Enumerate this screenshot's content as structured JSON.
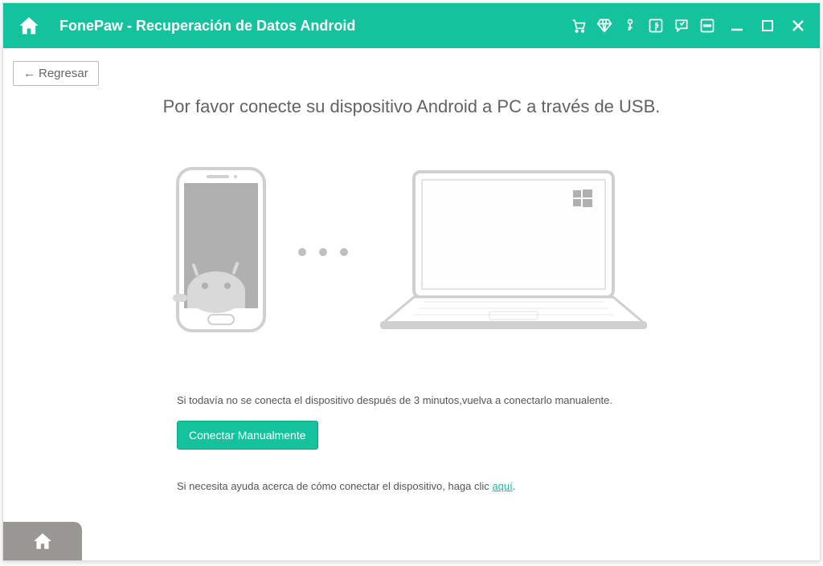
{
  "header": {
    "title": "FonePaw - Recuperación de Datos Android"
  },
  "back": {
    "label": "Regresar"
  },
  "main": {
    "heading": "Por favor conecte su dispositivo Android a PC a través de USB.",
    "hint": "Si todavía no se conecta el dispositivo después de 3 minutos,vuelva a conectarlo manualente.",
    "connect_button": "Conectar Manualmente",
    "help_prefix": "Si necesita ayuda acerca de cómo conectar el dispositivo, haga clic ",
    "help_link": "aquí",
    "help_suffix": "."
  }
}
